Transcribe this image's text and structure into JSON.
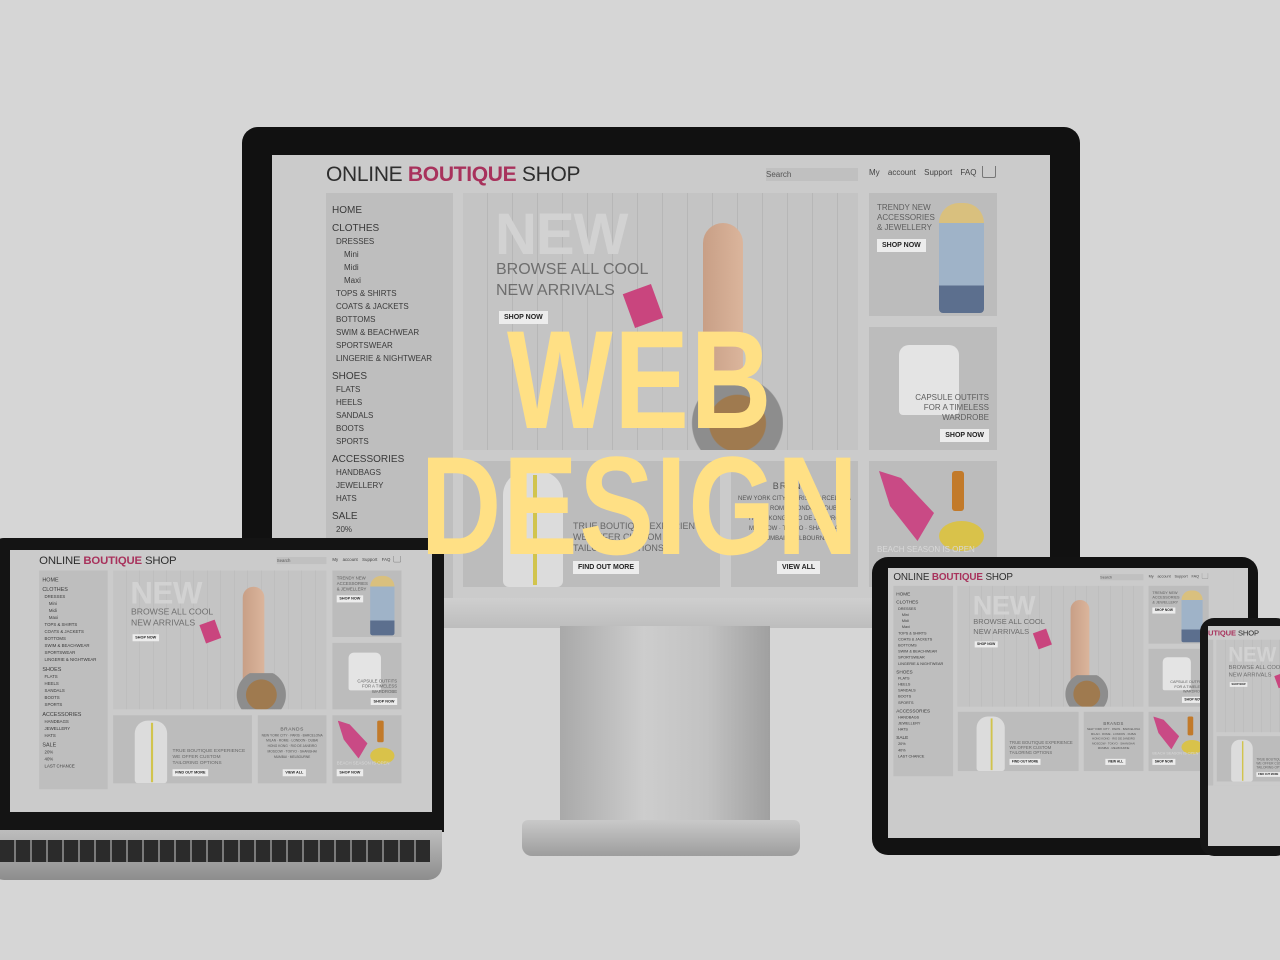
{
  "headline": {
    "line1": "WEB",
    "line2": "DESIGN",
    "color": "#ffe085"
  },
  "site": {
    "logo": {
      "part1": "ONLINE ",
      "accent": "BOUTIQUE",
      "part2": " SHOP",
      "accent_color": "#a8325c"
    },
    "search_placeholder": "Search",
    "links": [
      "My account",
      "Support",
      "FAQ"
    ],
    "cart_icon": "cart-icon",
    "sidebar": {
      "home": "HOME",
      "clothes": {
        "label": "CLOTHES",
        "dresses": "DRESSES",
        "dress_types": [
          "Mini",
          "Midi",
          "Maxi"
        ],
        "items": [
          "TOPS & SHIRTS",
          "COATS & JACKETS",
          "BOTTOMS",
          "SWIM & BEACHWEAR",
          "SPORTSWEAR",
          "LINGERIE & NIGHTWEAR"
        ]
      },
      "shoes": {
        "label": "SHOES",
        "items": [
          "FLATS",
          "HEELS",
          "SANDALS",
          "BOOTS",
          "SPORTS"
        ]
      },
      "accessories": {
        "label": "ACCESSORIES",
        "items": [
          "HANDBAGS",
          "JEWELLERY",
          "HATS"
        ]
      },
      "sale": {
        "label": "SALE",
        "items": [
          "20%",
          "40%",
          "LAST CHANCE"
        ]
      }
    },
    "hero": {
      "big": "NEW",
      "line1": "BROWSE ALL COOL",
      "line2": "NEW ARRIVALS",
      "button": "SHOP NOW"
    },
    "card_accessories": {
      "l1": "TRENDY NEW",
      "l2": "ACCESSORIES",
      "l3": "& JEWELLERY",
      "button": "SHOP NOW"
    },
    "card_capsule": {
      "l1": "CAPSULE OUTFITS",
      "l2": "FOR A TIMELESS",
      "l3": "WARDROBE",
      "button": "SHOP NOW"
    },
    "card_beach": {
      "l1": "BEACH SEASON IS OPEN",
      "button": "SHOP NOW"
    },
    "tailoring": {
      "l1": "TRUE BOUTIQUE EXPERIENCE",
      "l2": "WE OFFER CUSTOM",
      "l3": "TAILORING OPTIONS",
      "button": "FIND OUT MORE"
    },
    "brands": {
      "title": "BRANDS",
      "lines": [
        "NEW YORK CITY · PARIS · BARCELONA",
        "MILAN · ROME · LONDON · DUBAI",
        "HONG KONG · RIO DE JANEIRO",
        "MOSCOW · TOKYO · SHANGHAI",
        "MUMBAI · MELBOURNE"
      ],
      "button": "VIEW ALL"
    }
  }
}
